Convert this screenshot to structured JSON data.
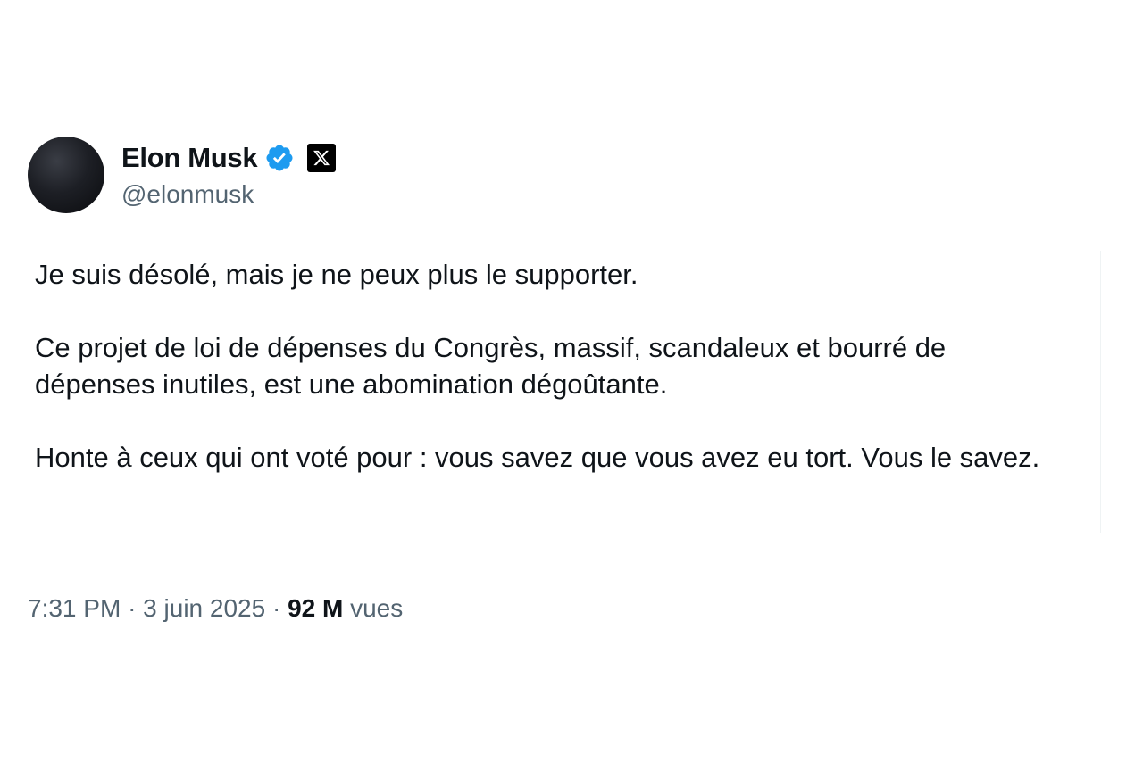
{
  "author": {
    "display_name": "Elon Musk",
    "handle": "@elonmusk",
    "verified_icon": "verified-badge-icon",
    "affiliate_icon": "x-logo-icon",
    "verified_color": "#1d9bf0"
  },
  "tweet": {
    "paragraphs": [
      "Je suis désolé, mais je ne peux plus le supporter.",
      "Ce projet de loi de dépenses du Congrès, massif, scandaleux et bourré de dépenses inutiles, est une abomination dégoûtante.",
      "Honte à ceux qui ont voté pour : vous savez que vous avez eu tort. Vous le savez."
    ]
  },
  "meta": {
    "time": "7:31 PM",
    "separator": "·",
    "date": "3 juin 2025",
    "views_count": "92 M",
    "views_label": "vues"
  },
  "colors": {
    "text_primary": "#0f1419",
    "text_secondary": "#536471"
  }
}
